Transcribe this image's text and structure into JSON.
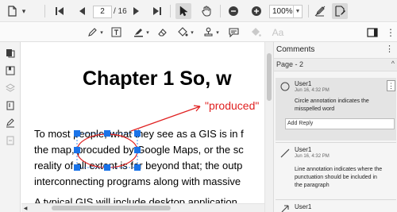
{
  "toolbar": {
    "current_page": "2",
    "page_total": "/ 16",
    "zoom": "100%"
  },
  "document": {
    "chapter_title": "Chapter 1  So, w",
    "produced_callout": "\"produced\"",
    "lines": [
      "To most people, what they see as a GIS is in f",
      "the map, procuded by Google Maps, or the sc",
      "reality of all extent is far beyond that; the outp",
      "interconnecting programs along with massive",
      "A typical GIS will include desktop application"
    ]
  },
  "comments": {
    "title": "Comments",
    "page_label": "Page - 2",
    "items": [
      {
        "user": "User1",
        "date": "Jun 16, 4:32 PM",
        "text": [
          "Circle annotation indicates the",
          "misspelled word"
        ],
        "reply_placeholder": "Add Reply"
      },
      {
        "user": "User1",
        "date": "Jun 16, 4:32 PM",
        "text": [
          "Line annotation indicates where the",
          "punctuation should be included in",
          "the paragraph"
        ]
      },
      {
        "user": "User1",
        "date": "Jun 16, 4:32 PM"
      }
    ]
  },
  "colors": {
    "accent_blue": "#1a73e8",
    "annotation_red": "#e02020"
  }
}
